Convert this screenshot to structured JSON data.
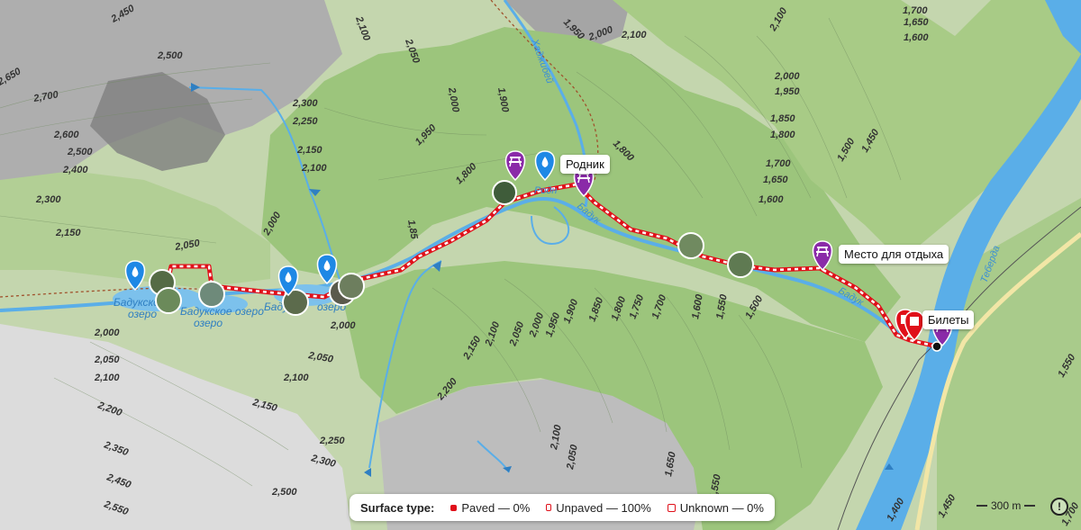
{
  "map": {
    "pois": {
      "spring_label": "Родник",
      "rest_label": "Место для отдыха",
      "tickets_label": "Билеты"
    },
    "rivers": {
      "hadzhibey": "Хаджибей",
      "baduk": "Бадук",
      "teberda": "Теберда",
      "lake_upper": "Бадукское озеро",
      "lake_left_1": "Бадукское",
      "lake_left_2": "озеро",
      "lake_mid": "Бадук",
      "lake_mid2": "озеро",
      "rodnik_small": "Родн"
    },
    "contours": [
      "2,450",
      "2,500",
      "2,650",
      "2,700",
      "2,600",
      "2,500",
      "2,400",
      "2,300",
      "2,150",
      "2,050",
      "2,000",
      "2,100",
      "2,200",
      "2,350",
      "2,450",
      "2,550",
      "2,500",
      "2,300",
      "2,250",
      "2,150",
      "2,100",
      "2,050",
      "2,300",
      "2,250",
      "2,150",
      "2,100",
      "2,000",
      "2,050",
      "1,950",
      "2,000",
      "1,900",
      "1,800",
      "1,85",
      "1,950",
      "2,000",
      "2,100",
      "1,800",
      "1,950",
      "2,000",
      "2,050",
      "2,100",
      "2,150",
      "2,200",
      "1,950",
      "1,900",
      "1,850",
      "1,800",
      "1,750",
      "1,700",
      "1,600",
      "1,550",
      "1,500",
      "2,100",
      "2,050",
      "1,650",
      "1,550",
      "2,100",
      "2,000",
      "1,950",
      "1,850",
      "1,800",
      "1,700",
      "1,650",
      "1,600",
      "1,500",
      "1,450",
      "1,700",
      "1,650",
      "1,600",
      "1,550",
      "1,400",
      "1,450",
      "1,700"
    ],
    "legend": {
      "title": "Surface type:",
      "paved": "Paved — 0%",
      "unpaved": "Unpaved — 100%",
      "unknown": "Unknown — 0%"
    },
    "scale": "300 m",
    "colors": {
      "forest": "#8fbf6d",
      "meadow": "#c9d8b6",
      "rock": "#9a9a9a",
      "water": "#5aaee8",
      "route": "#e0101a",
      "poi_purple": "#8a2aa8",
      "poi_blue": "#1e88e5"
    }
  }
}
